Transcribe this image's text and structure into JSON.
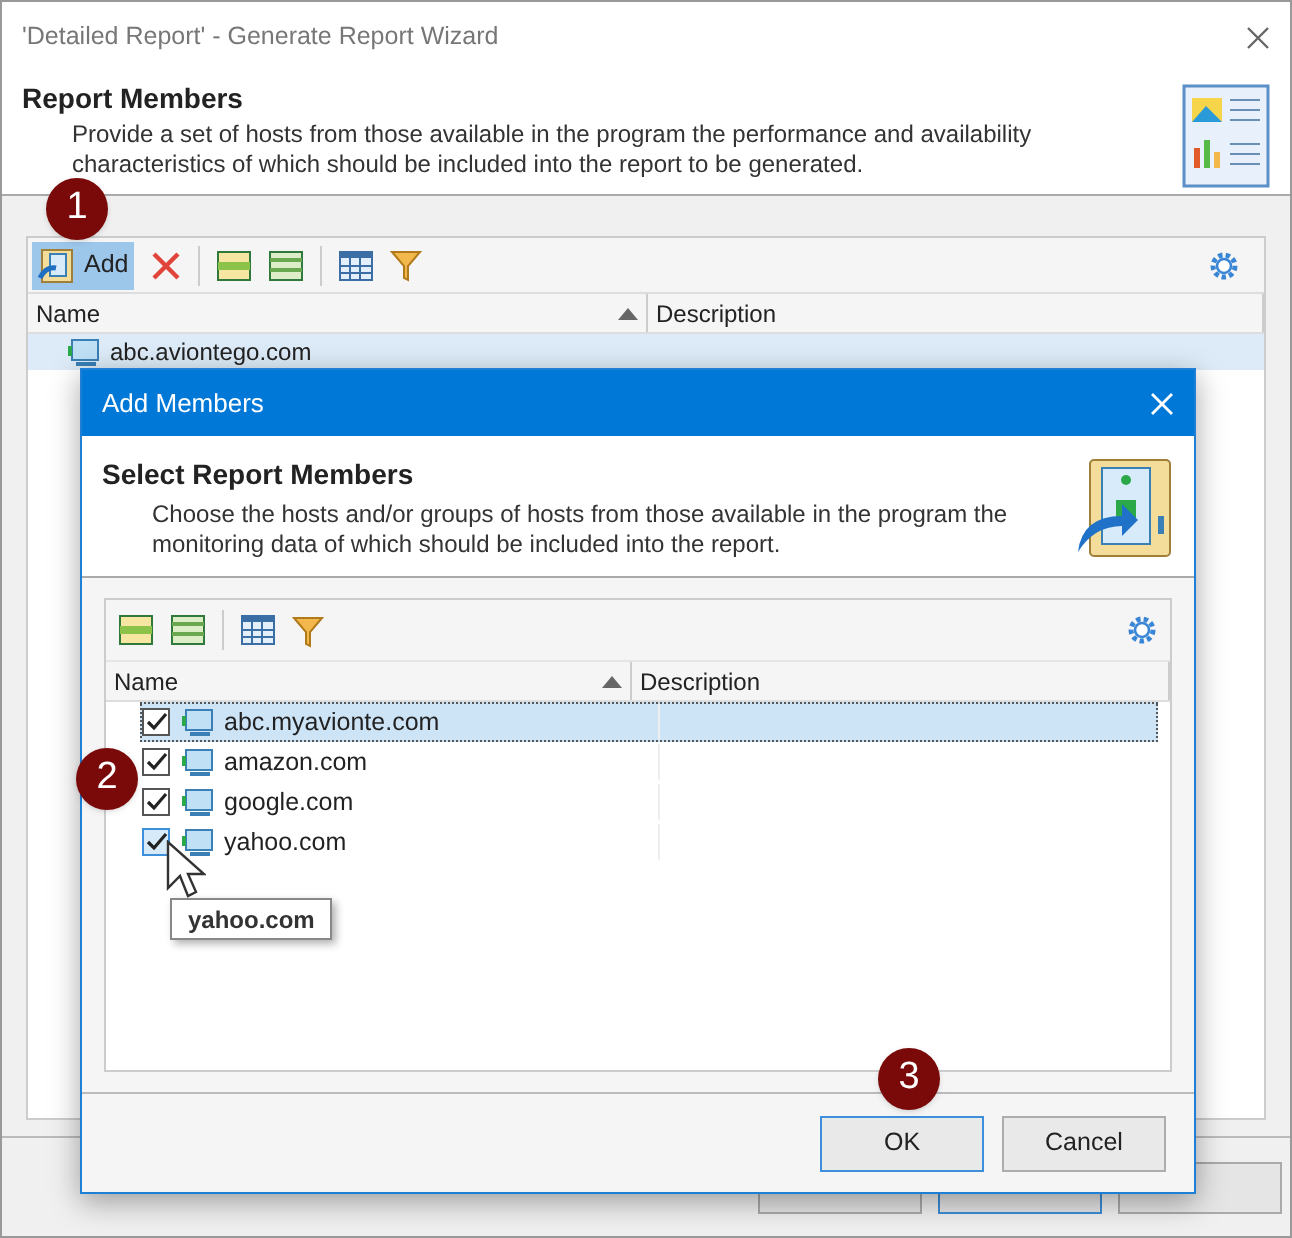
{
  "window": {
    "title": "'Detailed Report' - Generate Report Wizard"
  },
  "header": {
    "title": "Report Members",
    "description": "Provide a set of hosts from those available in the program the performance and availability characteristics of which should be included into the report to be generated."
  },
  "toolbar": {
    "add_label": "Add"
  },
  "table": {
    "columns": [
      {
        "label": "Name",
        "sorted": true
      },
      {
        "label": "Description",
        "sorted": false
      }
    ],
    "rows": [
      {
        "name": "abc.aviontego.com",
        "selected": true
      }
    ]
  },
  "dialog": {
    "title": "Add Members",
    "header_title": "Select Report Members",
    "description": "Choose the hosts and/or groups of hosts from those available in the program the monitoring data of which should be included into the report.",
    "columns": [
      {
        "label": "Name",
        "sorted": true
      },
      {
        "label": "Description",
        "sorted": false
      }
    ],
    "rows": [
      {
        "name": "abc.myavionte.com",
        "checked": true,
        "selected": true
      },
      {
        "name": "amazon.com",
        "checked": true,
        "selected": false
      },
      {
        "name": "google.com",
        "checked": true,
        "selected": false
      },
      {
        "name": "yahoo.com",
        "checked": true,
        "selected": false,
        "hovered": true
      }
    ],
    "tooltip": "yahoo.com",
    "buttons": [
      {
        "label": "OK",
        "default": true
      },
      {
        "label": "Cancel",
        "default": false
      }
    ]
  },
  "callouts": [
    "1",
    "2",
    "3"
  ]
}
